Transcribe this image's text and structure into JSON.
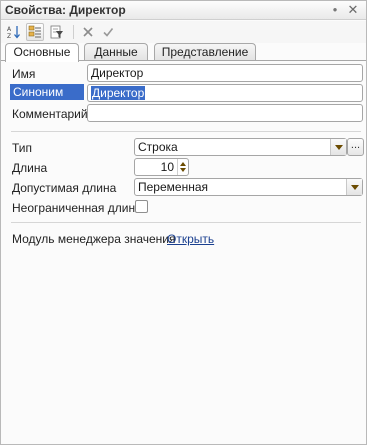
{
  "window": {
    "title": "Свойства: Директор",
    "menu_dot": "●",
    "close_glyph": "✕"
  },
  "toolbar": {
    "icons": [
      "sort-az-icon",
      "object-properties-icon",
      "filter-icon",
      "delete-icon",
      "check-icon"
    ]
  },
  "tabs": [
    {
      "label": "Основные",
      "active": true
    },
    {
      "label": "Данные",
      "active": false
    },
    {
      "label": "Представление",
      "active": false
    }
  ],
  "fields": {
    "name": {
      "label": "Имя",
      "value": "Директор"
    },
    "synonym": {
      "label": "Синоним",
      "value": "Директор"
    },
    "comment": {
      "label": "Комментарий",
      "value": ""
    },
    "type": {
      "label": "Тип",
      "value": "Строка",
      "button": "..."
    },
    "length": {
      "label": "Длина",
      "value": "10"
    },
    "allowed_length": {
      "label": "Допустимая длина",
      "value": "Переменная"
    },
    "unlimited_length": {
      "label": "Неограниченная длина",
      "checked": false
    }
  },
  "module": {
    "label": "Модуль менеджера значения",
    "link": "Открыть"
  },
  "colors": {
    "selection": "#3a6cc9",
    "link": "#1a3f8f",
    "arrow": "#6b4b00"
  }
}
